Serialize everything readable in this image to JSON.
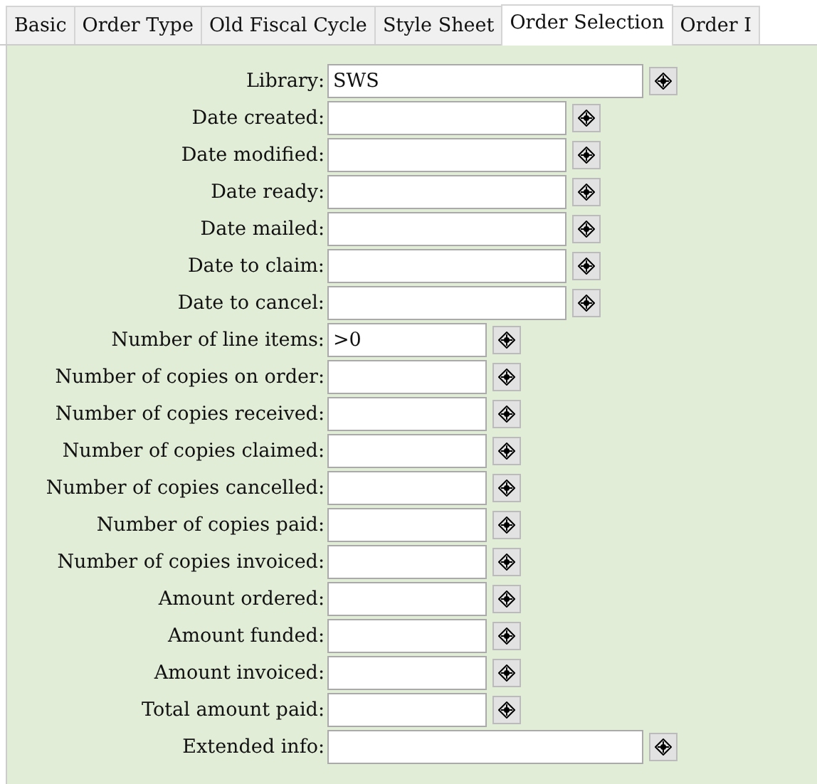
{
  "tabs": [
    {
      "label": "Basic",
      "selected": false
    },
    {
      "label": "Order Type",
      "selected": false
    },
    {
      "label": "Old Fiscal Cycle",
      "selected": false
    },
    {
      "label": "Style Sheet",
      "selected": false
    },
    {
      "label": "Order Selection",
      "selected": true
    },
    {
      "label": "Order I",
      "selected": false
    }
  ],
  "fields": [
    {
      "label": "Library:",
      "value": "SWS",
      "kind": "wide"
    },
    {
      "label": "Date created:",
      "kind": "medium"
    },
    {
      "label": "Date modified:",
      "kind": "medium"
    },
    {
      "label": "Date ready:",
      "kind": "medium"
    },
    {
      "label": "Date mailed:",
      "kind": "medium"
    },
    {
      "label": "Date to claim:",
      "kind": "medium"
    },
    {
      "label": "Date to cancel:",
      "kind": "medium"
    },
    {
      "label": "Number of line items:",
      "value": ">0",
      "kind": "narrow"
    },
    {
      "label": "Number of copies on order:",
      "kind": "narrow"
    },
    {
      "label": "Number of copies received:",
      "kind": "narrow"
    },
    {
      "label": "Number of copies claimed:",
      "kind": "narrow"
    },
    {
      "label": "Number of copies cancelled:",
      "kind": "narrow"
    },
    {
      "label": "Number of copies paid:",
      "kind": "narrow"
    },
    {
      "label": "Number of copies invoiced:",
      "kind": "narrow"
    },
    {
      "label": "Amount ordered:",
      "kind": "narrow"
    },
    {
      "label": "Amount funded:",
      "kind": "narrow"
    },
    {
      "label": "Amount invoiced:",
      "kind": "narrow"
    },
    {
      "label": "Total amount paid:",
      "kind": "narrow"
    },
    {
      "label": "Extended info:",
      "kind": "wide"
    }
  ]
}
